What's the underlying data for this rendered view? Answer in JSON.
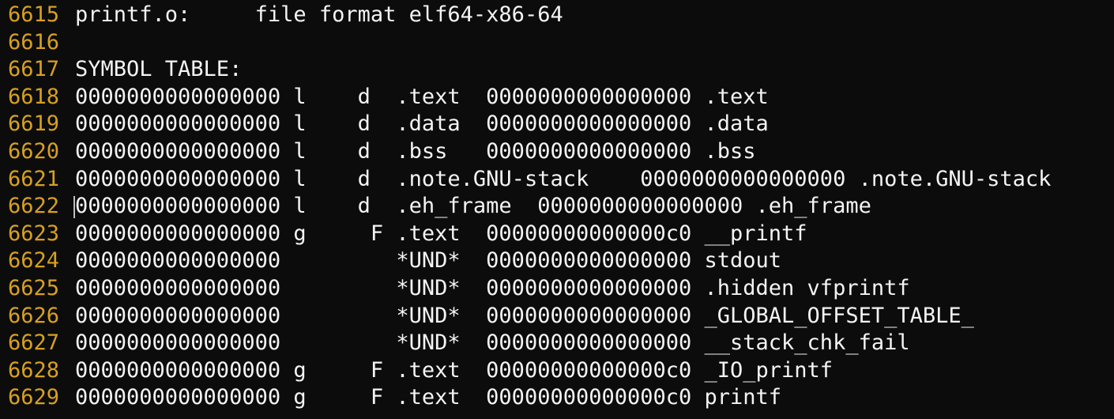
{
  "editor": {
    "lines": [
      {
        "number": "6615",
        "text": "printf.o:     file format elf64-x86-64"
      },
      {
        "number": "6616",
        "text": ""
      },
      {
        "number": "6617",
        "text": "SYMBOL TABLE:"
      },
      {
        "number": "6618",
        "text": "0000000000000000 l    d  .text  0000000000000000 .text"
      },
      {
        "number": "6619",
        "text": "0000000000000000 l    d  .data  0000000000000000 .data"
      },
      {
        "number": "6620",
        "text": "0000000000000000 l    d  .bss   0000000000000000 .bss"
      },
      {
        "number": "6621",
        "text": "0000000000000000 l    d  .note.GNU-stack    0000000000000000 .note.GNU-stack"
      },
      {
        "number": "6622",
        "text": "0000000000000000 l    d  .eh_frame  0000000000000000 .eh_frame"
      },
      {
        "number": "6623",
        "text": "0000000000000000 g     F .text  00000000000000c0 __printf"
      },
      {
        "number": "6624",
        "text": "0000000000000000         *UND*  0000000000000000 stdout"
      },
      {
        "number": "6625",
        "text": "0000000000000000         *UND*  0000000000000000 .hidden vfprintf"
      },
      {
        "number": "6626",
        "text": "0000000000000000         *UND*  0000000000000000 _GLOBAL_OFFSET_TABLE_"
      },
      {
        "number": "6627",
        "text": "0000000000000000         *UND*  0000000000000000 __stack_chk_fail"
      },
      {
        "number": "6628",
        "text": "0000000000000000 g     F .text  00000000000000c0 _IO_printf"
      },
      {
        "number": "6629",
        "text": "0000000000000000 g     F .text  00000000000000c0 printf"
      }
    ]
  },
  "colors": {
    "background": "#0c0c0c",
    "line_number": "#d7a020",
    "text": "#f4f4f4"
  }
}
